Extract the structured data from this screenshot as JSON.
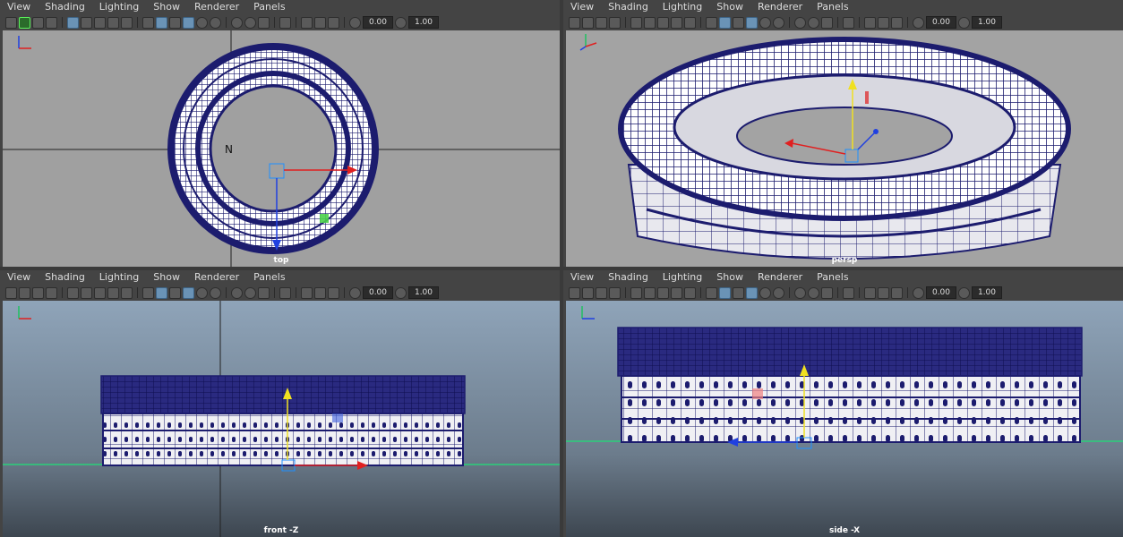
{
  "menus": [
    "View",
    "Shading",
    "Lighting",
    "Show",
    "Renderer",
    "Panels"
  ],
  "toolbar": {
    "field_a": "0.00",
    "field_b": "1.00"
  },
  "panes": [
    {
      "camera": "top"
    },
    {
      "camera": "persp"
    },
    {
      "camera": "front -Z"
    },
    {
      "camera": "side -X"
    }
  ],
  "colors": {
    "wire": "#1c1c6e",
    "x_axis": "#e02020",
    "y_axis": "#f0e020",
    "z_axis": "#2040e0",
    "ground": "#2ad07a"
  }
}
